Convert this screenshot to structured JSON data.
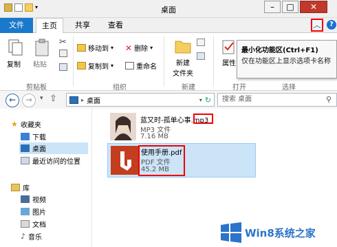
{
  "window": {
    "title": "桌面"
  },
  "tabs": {
    "file": "文件",
    "home": "主页",
    "share": "共享",
    "view": "查看"
  },
  "ribbon": {
    "copy": "复制",
    "paste": "粘贴",
    "move_to": "移动到",
    "copy_to": "复制到",
    "delete": "删除",
    "rename": "重命名",
    "new_folder_line1": "新建",
    "new_folder_line2": "文件夹",
    "properties": "属性",
    "group_clipboard": "剪贴板",
    "group_organize": "组织",
    "group_new": "新建",
    "group_open": "打开",
    "group_select": "选择"
  },
  "tooltip": {
    "title": "最小化功能区(Ctrl+F1)",
    "description": "仅在功能区上显示选项卡名称"
  },
  "address": {
    "path": "桌面",
    "search_placeholder": "搜索 桌面"
  },
  "navpane": {
    "favorites": "收藏夹",
    "downloads": "下载",
    "desktop": "桌面",
    "recent": "最近访问的位置",
    "libraries": "库",
    "videos": "视频",
    "pictures": "图片",
    "documents": "文档",
    "music": "音乐"
  },
  "files": [
    {
      "name_prefix": "蓝又时-孤单心事",
      "name_ext": ".mp3",
      "type": "MP3 文件",
      "size": "7.16 MB"
    },
    {
      "name": "使用手册.pdf",
      "type": "PDF 文件",
      "size": "45.2 MB"
    }
  ],
  "watermark": {
    "text": "Win8系统之家"
  },
  "colors": {
    "accent": "#1979ca",
    "highlight": "#e00000",
    "selection": "#cce4f7"
  }
}
